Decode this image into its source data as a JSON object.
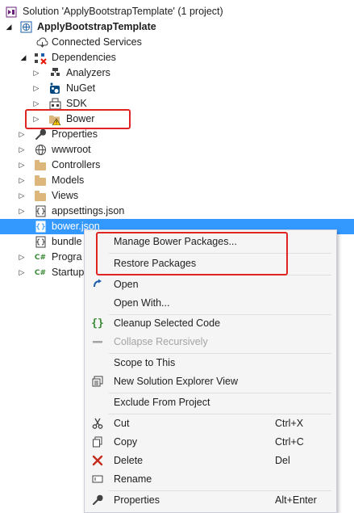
{
  "solution_explorer": {
    "items": [
      {
        "label": "Solution 'ApplyBootstrapTemplate' (1 project)",
        "icon": "solution-icon"
      },
      {
        "label": "ApplyBootstrapTemplate",
        "icon": "web-project-icon"
      },
      {
        "label": "Connected Services",
        "icon": "connected-services-icon"
      },
      {
        "label": "Dependencies",
        "icon": "dependencies-icon"
      },
      {
        "label": "Analyzers",
        "icon": "analyzers-icon"
      },
      {
        "label": "NuGet",
        "icon": "nuget-icon"
      },
      {
        "label": "SDK",
        "icon": "sdk-icon"
      },
      {
        "label": "Bower",
        "icon": "bower-warning-folder-icon"
      },
      {
        "label": "Properties",
        "icon": "wrench-icon"
      },
      {
        "label": "wwwroot",
        "icon": "globe-icon"
      },
      {
        "label": "Controllers",
        "icon": "folder-icon"
      },
      {
        "label": "Models",
        "icon": "folder-icon"
      },
      {
        "label": "Views",
        "icon": "folder-icon"
      },
      {
        "label": "appsettings.json",
        "icon": "json-file-icon"
      },
      {
        "label": "bower.json",
        "icon": "json-file-icon"
      },
      {
        "label": "bundle",
        "icon": "json-file-icon"
      },
      {
        "label": "Progra",
        "icon": "csharp-file-icon"
      },
      {
        "label": "Startup",
        "icon": "csharp-file-icon"
      }
    ],
    "selected_item": "bower.json",
    "cs_glyph": "C#"
  },
  "context_menu": {
    "items": [
      {
        "label": "Manage Bower Packages...",
        "shortcut": "",
        "icon": "",
        "enabled": true
      },
      {
        "label": "Restore Packages",
        "shortcut": "",
        "icon": "",
        "enabled": true
      },
      {
        "label": "Open",
        "shortcut": "",
        "icon": "open-arrow-icon",
        "enabled": true
      },
      {
        "label": "Open With...",
        "shortcut": "",
        "icon": "",
        "enabled": true
      },
      {
        "label": "Cleanup Selected Code",
        "shortcut": "",
        "icon": "braces-icon",
        "enabled": true
      },
      {
        "label": "Collapse Recursively",
        "shortcut": "",
        "icon": "collapse-icon",
        "enabled": false
      },
      {
        "label": "Scope to This",
        "shortcut": "",
        "icon": "",
        "enabled": true
      },
      {
        "label": "New Solution Explorer View",
        "shortcut": "",
        "icon": "new-view-icon",
        "enabled": true
      },
      {
        "label": "Exclude From Project",
        "shortcut": "",
        "icon": "",
        "enabled": true
      },
      {
        "label": "Cut",
        "shortcut": "Ctrl+X",
        "icon": "scissors-icon",
        "enabled": true
      },
      {
        "label": "Copy",
        "shortcut": "Ctrl+C",
        "icon": "copy-icon",
        "enabled": true
      },
      {
        "label": "Delete",
        "shortcut": "Del",
        "icon": "delete-x-icon",
        "enabled": true
      },
      {
        "label": "Rename",
        "shortcut": "",
        "icon": "rename-icon",
        "enabled": true
      },
      {
        "label": "Properties",
        "shortcut": "Alt+Enter",
        "icon": "wrench-icon",
        "enabled": true
      }
    ]
  },
  "colors": {
    "selection": "#3399ff",
    "highlight_box": "#e02424",
    "menu_background": "#f5f5f5",
    "folder": "#dcb67a",
    "csharp": "#388a34"
  }
}
